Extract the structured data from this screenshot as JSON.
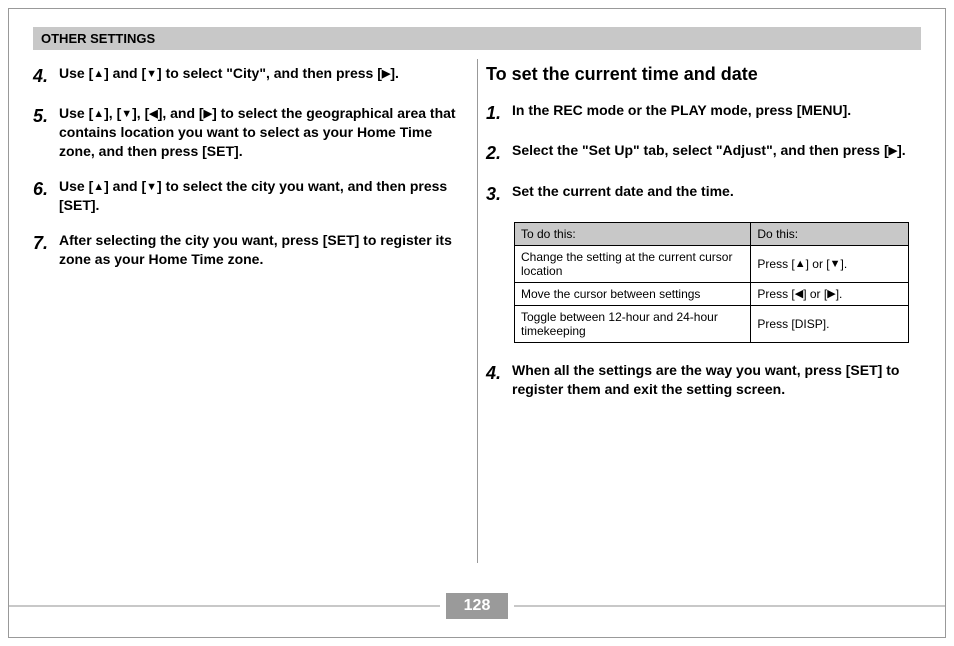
{
  "header": "OTHER SETTINGS",
  "pageNumber": "128",
  "triangles": {
    "up": "▲",
    "down": "▼",
    "left": "◀",
    "right": "▶"
  },
  "left": {
    "steps": [
      {
        "num": "4.",
        "pre": "Use [",
        "mid1": "] and [",
        "mid2": "] to select \"City\", and then press [",
        "post": "]."
      },
      {
        "num": "5.",
        "pre": "Use [",
        "mid1": "], [",
        "mid2": "], [",
        "mid3": "], and [",
        "mid4": "] to select the geographical area that contains location you want to select as your Home Time zone, and then press [SET]."
      },
      {
        "num": "6.",
        "pre": "Use [",
        "mid1": "] and [",
        "mid2": "] to select the city you want, and then press [SET]."
      },
      {
        "num": "7.",
        "text": "After selecting the city you want, press [SET] to register its zone as your Home Time zone."
      }
    ]
  },
  "right": {
    "heading": "To set the current time and date",
    "steps": [
      {
        "num": "1.",
        "text": "In the REC mode or the PLAY mode, press [MENU]."
      },
      {
        "num": "2.",
        "pre": "Select the \"Set Up\" tab, select \"Adjust\", and then press [",
        "post": "]."
      },
      {
        "num": "3.",
        "text": "Set the current date and the time."
      },
      {
        "num": "4.",
        "text": "When all the settings are the way you want, press [SET] to register them and exit the setting screen."
      }
    ],
    "table": {
      "headers": [
        "To do this:",
        "Do this:"
      ],
      "rows": [
        {
          "c1": "Change the setting at the current cursor location",
          "c2pre": "Press [",
          "c2mid": "] or [",
          "c2post": "].",
          "ic1": "up",
          "ic2": "down"
        },
        {
          "c1": "Move the cursor between settings",
          "c2pre": "Press [",
          "c2mid": "] or [",
          "c2post": "].",
          "ic1": "left",
          "ic2": "right"
        },
        {
          "c1": "Toggle between 12-hour and 24-hour timekeeping",
          "c2plain": "Press [DISP]."
        }
      ]
    }
  }
}
